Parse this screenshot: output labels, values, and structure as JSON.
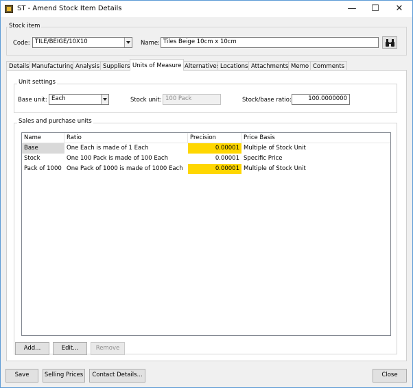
{
  "window": {
    "title": "ST - Amend Stock Item Details"
  },
  "titlebar": {
    "minimize": "—",
    "maximize": "☐",
    "close": "✕"
  },
  "stock_item": {
    "group_label": "Stock item",
    "code_label": "Code:",
    "code_value": "TILE/BEIGE/10X10",
    "name_label": "Name:",
    "name_value": "Tiles Beige 10cm x 10cm"
  },
  "tabs": [
    "Details",
    "Manufacturing",
    "Analysis",
    "Suppliers",
    "Units of Measure",
    "Alternatives",
    "Locations",
    "Attachments",
    "Memo",
    "Comments"
  ],
  "active_tab": "Units of Measure",
  "unit_settings": {
    "group_label": "Unit settings",
    "base_unit_label": "Base unit:",
    "base_unit_value": "Each",
    "stock_unit_label": "Stock unit:",
    "stock_unit_value": "100 Pack",
    "ratio_label": "Stock/base ratio:",
    "ratio_value": "100.0000000"
  },
  "sales_purchase": {
    "group_label": "Sales and purchase units",
    "columns": [
      "Name",
      "Ratio",
      "Precision",
      "Price Basis"
    ],
    "rows": [
      {
        "name": "Base",
        "ratio": "One Each is made of 1 Each",
        "precision": "0.00001",
        "price_basis": "Multiple of Stock Unit"
      },
      {
        "name": "Stock",
        "ratio": "One 100 Pack is made of 100 Each",
        "precision": "0.00001",
        "price_basis": "Specific Price"
      },
      {
        "name": "Pack of 1000",
        "ratio": "One Pack of 1000 is made of 1000 Each",
        "precision": "0.00001",
        "price_basis": "Multiple of Stock Unit"
      }
    ],
    "add_button": "Add...",
    "edit_button": "Edit...",
    "remove_button": "Remove"
  },
  "footer": {
    "save": "Save",
    "selling_prices": "Selling Prices",
    "contact_details": "Contact Details...",
    "close": "Close"
  },
  "colors": {
    "highlight": "#ffd700",
    "selected_cell": "#d9d9d9",
    "window_border": "#5c9bd6"
  }
}
